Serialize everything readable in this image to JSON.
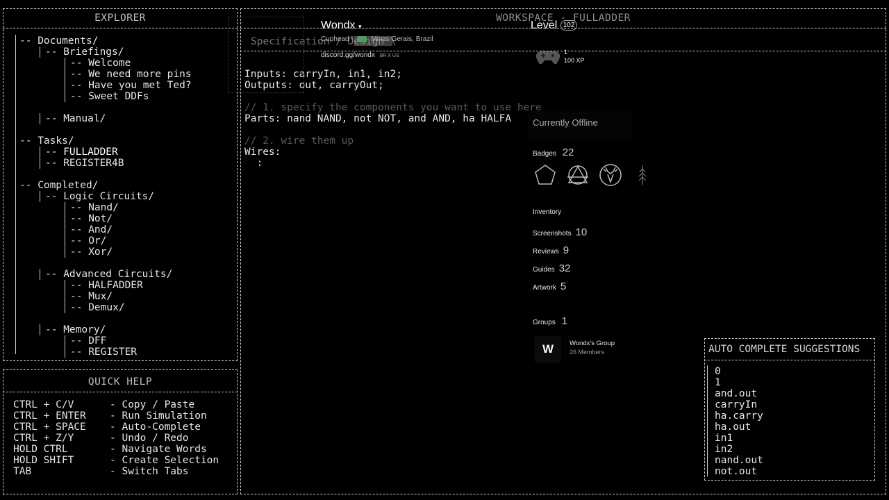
{
  "explorer": {
    "title": "EXPLORER",
    "tree": [
      {
        "text": "-- Documents/",
        "indent": 0
      },
      {
        "text": "-- Briefings/",
        "indent": 1
      },
      {
        "text": "-- Welcome",
        "indent": 2
      },
      {
        "text": "-- We need more pins",
        "indent": 2
      },
      {
        "text": "-- Have you met Ted?",
        "indent": 2
      },
      {
        "text": "-- Sweet DDFs",
        "indent": 2
      },
      {
        "text": "",
        "indent": 0
      },
      {
        "text": "-- Manual/",
        "indent": 1
      },
      {
        "text": "",
        "indent": 0
      },
      {
        "text": "-- Tasks/",
        "indent": 0
      },
      {
        "text": "-- FULLADDER",
        "indent": 1,
        "active": true
      },
      {
        "text": "-- REGISTER4B",
        "indent": 1
      },
      {
        "text": "",
        "indent": 0
      },
      {
        "text": "-- Completed/",
        "indent": 0
      },
      {
        "text": "-- Logic Circuits/",
        "indent": 1
      },
      {
        "text": "-- Nand/",
        "indent": 2
      },
      {
        "text": "-- Not/",
        "indent": 2
      },
      {
        "text": "-- And/",
        "indent": 2
      },
      {
        "text": "-- Or/",
        "indent": 2
      },
      {
        "text": "-- Xor/",
        "indent": 2
      },
      {
        "text": "",
        "indent": 0
      },
      {
        "text": "-- Advanced Circuits/",
        "indent": 1
      },
      {
        "text": "-- HALFADDER",
        "indent": 2
      },
      {
        "text": "-- Mux/",
        "indent": 2
      },
      {
        "text": "-- Demux/",
        "indent": 2
      },
      {
        "text": "",
        "indent": 0
      },
      {
        "text": "-- Memory/",
        "indent": 1
      },
      {
        "text": "-- DFF",
        "indent": 2
      },
      {
        "text": "-- REGISTER",
        "indent": 2
      }
    ]
  },
  "quick_help": {
    "title": "QUICK HELP",
    "items": [
      {
        "keys": "CTRL + C/V",
        "desc": "- Copy / Paste"
      },
      {
        "keys": "CTRL + ENTER",
        "desc": "- Run Simulation"
      },
      {
        "keys": "CTRL + SPACE",
        "desc": "- Auto-Complete"
      },
      {
        "keys": "CTRL + Z/Y",
        "desc": "- Undo / Redo"
      },
      {
        "keys": "HOLD CTRL",
        "desc": "- Navigate Words"
      },
      {
        "keys": "HOLD SHIFT",
        "desc": "- Create Selection"
      },
      {
        "keys": "TAB",
        "desc": "- Switch Tabs"
      }
    ]
  },
  "workspace": {
    "title": "WORKSPACE - FULLADDER",
    "tabs_text": "Specification / Design \\",
    "code_lines": [
      {
        "text": "Inputs: carryIn, in1, in2;",
        "style": "normal"
      },
      {
        "text": "Outputs: out, carryOut;",
        "style": "normal"
      },
      {
        "text": "",
        "style": "normal"
      },
      {
        "text": "// 1. specify the components you want to use here",
        "style": "comment"
      },
      {
        "text": "Parts: nand NAND, not NOT, and AND, ha HALFA",
        "style": "normal"
      },
      {
        "text": "",
        "style": "normal"
      },
      {
        "text": "// 2. wire them up",
        "style": "comment"
      },
      {
        "text": "Wires:",
        "style": "normal"
      },
      {
        "text": "  :",
        "style": "normal"
      }
    ]
  },
  "autocomplete": {
    "title": "AUTO COMPLETE SUGGESTIONS",
    "items": [
      "0",
      "1",
      "and.out",
      "carryIn",
      "ha.carry",
      "ha.out",
      "in1",
      "in2",
      "nand.out",
      "not.out"
    ]
  },
  "overlay": {
    "username": "Wondx",
    "username_caret": "▾",
    "subtitle": "Cuphead ¹",
    "location": "Minas Gerais, Brazil",
    "discord": "discord.gg/wondx",
    "langs": "BR X US",
    "level_label": "Level",
    "level_value": "102",
    "xp_top": "1",
    "xp_value": "100 XP",
    "status": "Currently Offline",
    "badges_label": "Badges",
    "badges_count": "22",
    "stats": [
      {
        "label": "Inventory",
        "value": ""
      },
      {
        "label": "Screenshots",
        "value": "10"
      },
      {
        "label": "Reviews",
        "value": "9"
      },
      {
        "label": "Guides",
        "value": "32"
      },
      {
        "label": "Artwork",
        "value": "5"
      }
    ],
    "groups_label": "Groups",
    "groups_count": "1",
    "group_name": "Wondx's Group",
    "group_members": "26 Members",
    "group_logo": "W"
  }
}
